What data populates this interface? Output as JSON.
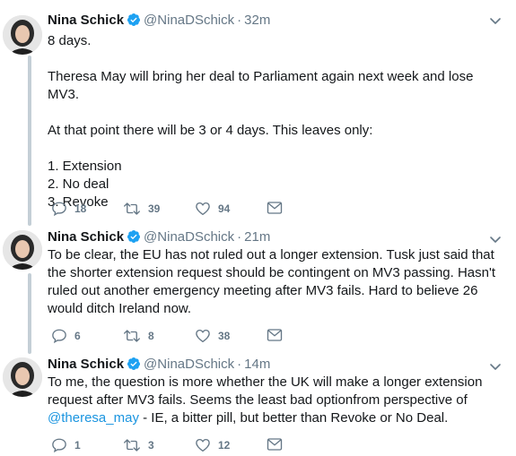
{
  "tweets": [
    {
      "name": "Nina Schick",
      "handle": "@NinaDSchick",
      "time": "32m",
      "paragraphs": [
        "8 days.",
        "Theresa May will bring her deal to Parliament again next week and lose MV3.",
        "At that point there will be 3 or 4 days. This leaves only:",
        "1. Extension",
        "2. No deal",
        "3. Revoke"
      ],
      "replies": "18",
      "retweets": "39",
      "likes": "94"
    },
    {
      "name": "Nina Schick",
      "handle": "@NinaDSchick",
      "time": "21m",
      "text": "To be clear, the EU has not ruled out a longer extension. Tusk just said that the shorter extension request should be contingent on MV3 passing. Hasn't  ruled out another emergency meeting after MV3 fails. Hard to believe 26 would ditch Ireland now.",
      "replies": "6",
      "retweets": "8",
      "likes": "38"
    },
    {
      "name": "Nina Schick",
      "handle": "@NinaDSchick",
      "time": "14m",
      "text_before": "To me, the question is more whether the UK will make a longer extension request after MV3 fails. Seems the least bad optionfrom perspective of ",
      "mention": "@theresa_may",
      "text_after": " - IE, a bitter pill, but better than Revoke or No Deal.",
      "replies": "1",
      "retweets": "3",
      "likes": "12"
    }
  ],
  "separator": "·",
  "icons": {
    "verified": "verified-badge-icon",
    "caret": "chevron-down-icon",
    "reply": "reply-icon",
    "retweet": "retweet-icon",
    "like": "heart-icon",
    "dm": "envelope-icon"
  },
  "colors": {
    "accent": "#1da1f2",
    "mention": "#1b95e0",
    "muted": "#657786",
    "thread_line": "#c4cfd6"
  }
}
